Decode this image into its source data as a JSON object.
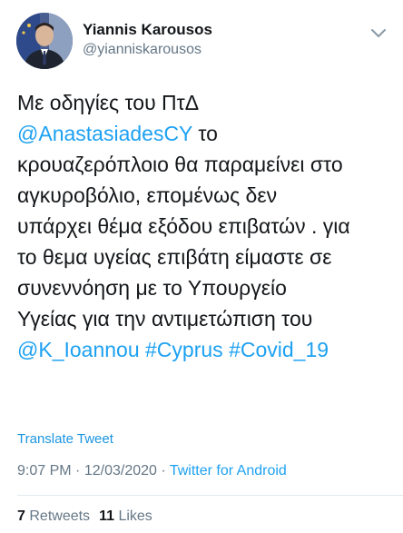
{
  "author": {
    "name": "Yiannis Karousos",
    "handle": "@yianniskarousos"
  },
  "tweet": {
    "lines": [
      [
        {
          "text": "Με οδηγίες του ΠτΔ",
          "link": false
        }
      ],
      [
        {
          "text": "@AnastasiadesCY",
          "link": true
        },
        {
          "text": " το",
          "link": false
        }
      ],
      [
        {
          "text": "κρουαζερόπλοιο θα παραμείνει στο",
          "link": false
        }
      ],
      [
        {
          "text": "αγκυροβόλιο, επομένως δεν",
          "link": false
        }
      ],
      [
        {
          "text": "υπάρχει θέμα εξόδου επιβατών . για",
          "link": false
        }
      ],
      [
        {
          "text": "το θεμα υγείας επιβάτη είμαστε σε",
          "link": false
        }
      ],
      [
        {
          "text": "συνεννόηση με το Υπουργείο",
          "link": false
        }
      ],
      [
        {
          "text": "Υγείας για την αντιμετώπιση του",
          "link": false
        }
      ],
      [
        {
          "text": "@K_Ioannou",
          "link": true
        },
        {
          "text": " ",
          "link": false
        },
        {
          "text": "#Cyprus",
          "link": true
        },
        {
          "text": " ",
          "link": false
        },
        {
          "text": "#Covid_19",
          "link": true
        }
      ]
    ],
    "translate_label": "Translate Tweet",
    "time": "9:07 PM",
    "date": "12/03/2020",
    "separator": "·",
    "source": "Twitter for Android"
  },
  "stats": {
    "retweets_count": "7",
    "retweets_label": "Retweets",
    "likes_count": "11",
    "likes_label": "Likes"
  },
  "colors": {
    "link": "#1da1f2",
    "muted": "#657786",
    "text": "#14171a"
  },
  "icons": {
    "menu": "chevron-down-icon"
  }
}
